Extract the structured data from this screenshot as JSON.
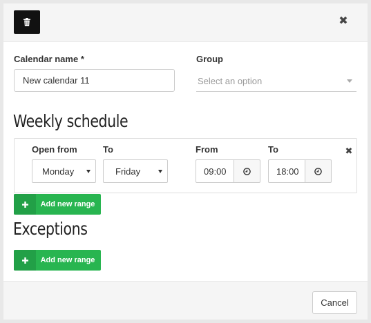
{
  "header": {
    "delete_icon": "trash-icon",
    "close_icon": "close-icon",
    "close_glyph": "✖"
  },
  "form": {
    "calendar_name_label": "Calendar name *",
    "calendar_name_value": "New calendar 11",
    "group_label": "Group",
    "group_placeholder": "Select an option"
  },
  "weekly_schedule": {
    "title": "Weekly schedule",
    "columns": {
      "open_from": "Open from",
      "to_day": "To",
      "from_time": "From",
      "to_time": "To"
    },
    "rows": [
      {
        "open_from": "Monday",
        "to_day": "Friday",
        "from_time": "09:00",
        "to_time": "18:00",
        "remove_glyph": "✖"
      }
    ],
    "add_button_label": "Add new range",
    "add_icon": "plus-icon"
  },
  "exceptions": {
    "title": "Exceptions",
    "add_button_label": "Add new range"
  },
  "footer": {
    "cancel_label": "Cancel"
  },
  "colors": {
    "accent_green": "#28b550",
    "accent_green_dark": "#22a047",
    "delete_button_bg": "#111111"
  }
}
